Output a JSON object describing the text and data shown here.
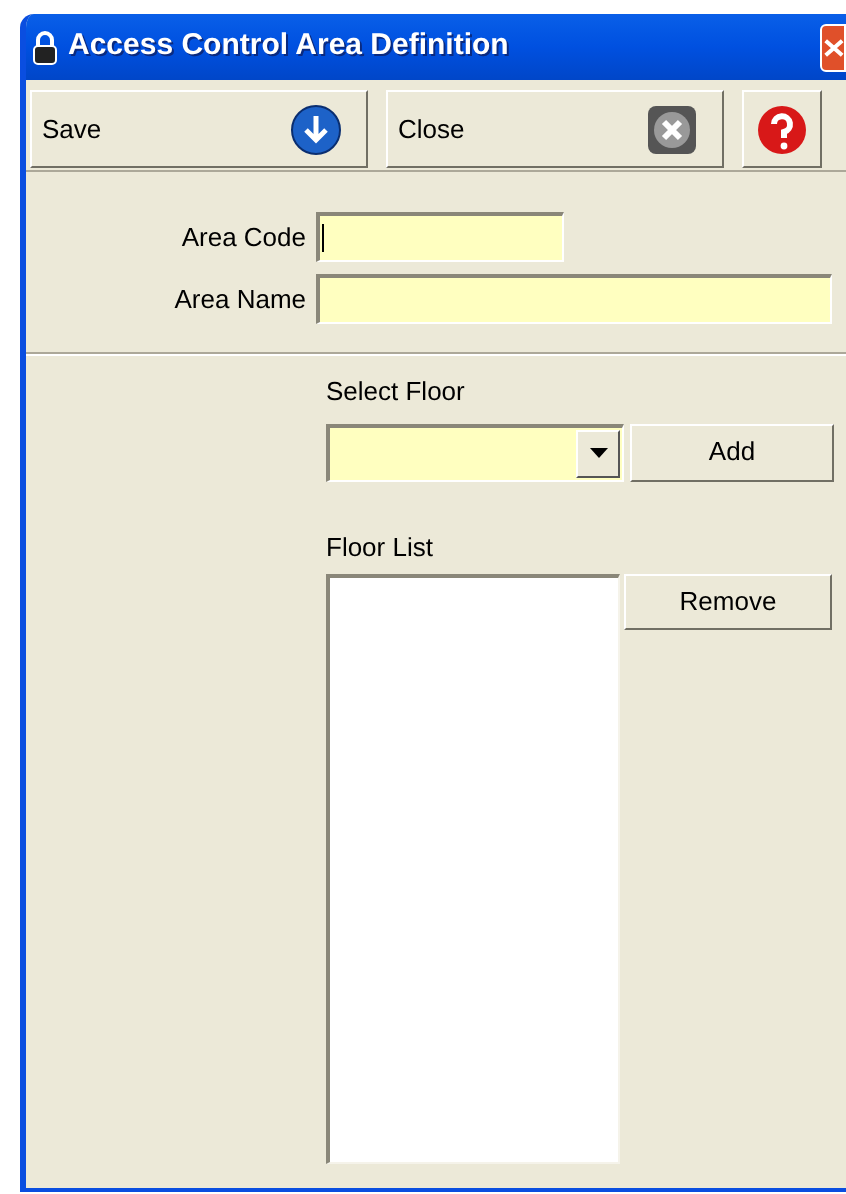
{
  "window": {
    "title": "Access Control Area Definition"
  },
  "toolbar": [
    {
      "label": "Save",
      "kind": "save"
    },
    {
      "label": "Close",
      "kind": "close"
    },
    {
      "kind": "help"
    }
  ],
  "form": {
    "area_code_label": "Area Code",
    "area_name_label": "Area Name",
    "select_floor_label": "Select Floor",
    "add_button": "Add",
    "floor_list_label": "Floor List",
    "remove_button": "Remove"
  }
}
